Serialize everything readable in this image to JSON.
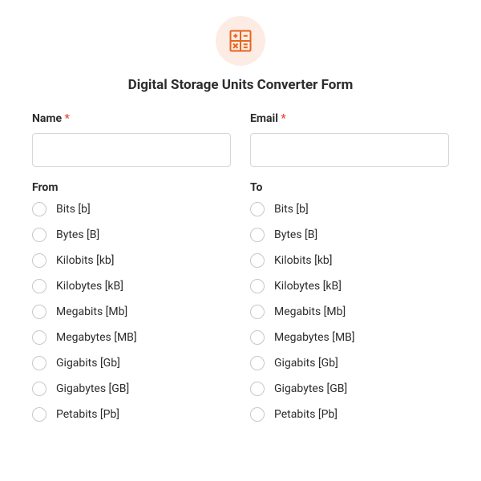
{
  "header": {
    "title": "Digital Storage Units Converter Form",
    "icon": "calculator-icon"
  },
  "fields": {
    "name": {
      "label": "Name",
      "required": "*",
      "value": ""
    },
    "email": {
      "label": "Email",
      "required": "*",
      "value": ""
    }
  },
  "from": {
    "label": "From",
    "options": [
      "Bits [b]",
      "Bytes [B]",
      "Kilobits [kb]",
      "Kilobytes [kB]",
      "Megabits [Mb]",
      "Megabytes [MB]",
      "Gigabits [Gb]",
      "Gigabytes [GB]",
      "Petabits [Pb]"
    ]
  },
  "to": {
    "label": "To",
    "options": [
      "Bits [b]",
      "Bytes [B]",
      "Kilobits [kb]",
      "Kilobytes [kB]",
      "Megabits [Mb]",
      "Megabytes [MB]",
      "Gigabits [Gb]",
      "Gigabytes [GB]",
      "Petabits [Pb]"
    ]
  }
}
